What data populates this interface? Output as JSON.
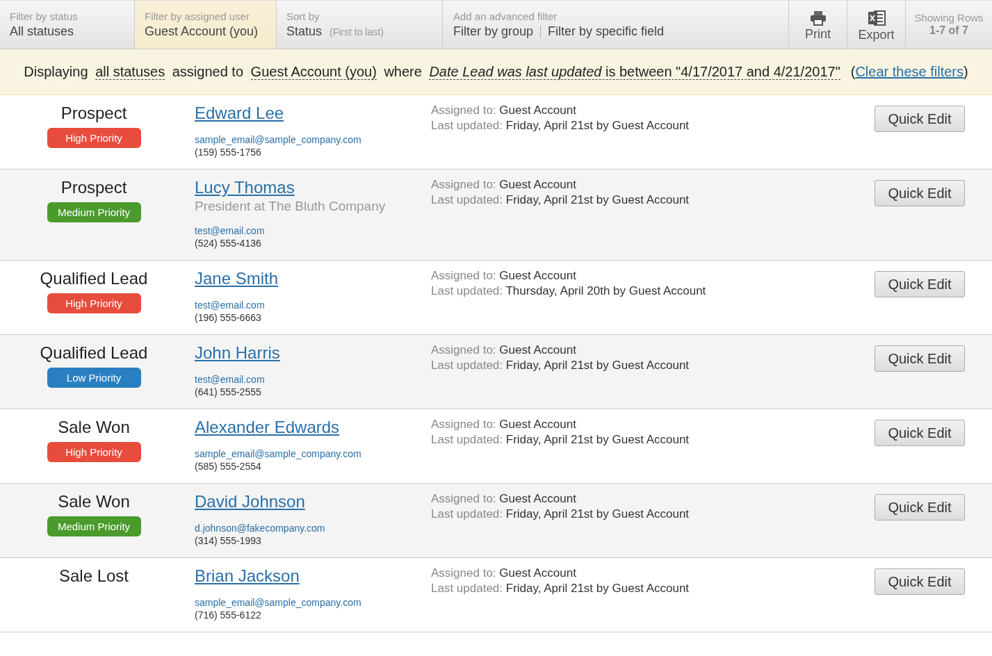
{
  "toolbar": {
    "tabs": [
      {
        "label": "Filter by status",
        "value": "All statuses",
        "selected": false
      },
      {
        "label": "Filter by assigned user",
        "value": "Guest Account (you)",
        "selected": true
      },
      {
        "label": "Sort by",
        "value": "Status",
        "note": "(First to last)",
        "selected": false
      }
    ],
    "advanced_filter": {
      "label": "Add an advanced filter",
      "links": [
        "Filter by group",
        "Filter by specific field"
      ]
    },
    "actions": [
      {
        "kind": "print",
        "label": "Print"
      },
      {
        "kind": "export",
        "label": "Export"
      }
    ],
    "row_count": {
      "label": "Showing Rows",
      "value": "1-7 of 7"
    }
  },
  "filter_summary": {
    "parts": [
      {
        "kind": "plain",
        "text": "Displaying"
      },
      {
        "kind": "value",
        "text": "all statuses"
      },
      {
        "kind": "plain",
        "text": "assigned to"
      },
      {
        "kind": "value",
        "text": "Guest Account (you)"
      },
      {
        "kind": "plain",
        "text": "where"
      },
      {
        "kind": "value",
        "text": "*Date Lead was last updated* is between \"4/17/2017 and 4/21/2017\""
      }
    ],
    "clear_open": "(",
    "clear_link": "Clear these filters",
    "clear_close": ")"
  },
  "leads": [
    {
      "status": "Prospect",
      "priority": {
        "label": "High Priority",
        "color": "#e74c3c"
      },
      "name": "Edward Lee",
      "email": "sample_email@sample_company.com",
      "phone": "(159) 555-1756",
      "assigned_label": "Assigned to:",
      "assigned": "Guest Account",
      "updated_label": "Last updated:",
      "updated": "Friday, April 21st by Guest Account",
      "action": "Quick Edit"
    },
    {
      "status": "Prospect",
      "priority": {
        "label": "Medium Priority",
        "color": "#4a9a2c"
      },
      "name": "Lucy Thomas",
      "subtitle": "President at The Bluth Company",
      "email": "test@email.com",
      "phone": "(524) 555-4136",
      "assigned_label": "Assigned to:",
      "assigned": "Guest Account",
      "updated_label": "Last updated:",
      "updated": "Friday, April 21st by Guest Account",
      "action": "Quick Edit"
    },
    {
      "status": "Qualified Lead",
      "priority": {
        "label": "High Priority",
        "color": "#e74c3c"
      },
      "name": "Jane Smith",
      "email": "test@email.com",
      "phone": "(196) 555-6663",
      "assigned_label": "Assigned to:",
      "assigned": "Guest Account",
      "updated_label": "Last updated:",
      "updated": "Thursday, April 20th by Guest Account",
      "action": "Quick Edit"
    },
    {
      "status": "Qualified Lead",
      "priority": {
        "label": "Low Priority",
        "color": "#2a7fc0"
      },
      "name": "John Harris",
      "email": "test@email.com",
      "phone": "(641) 555-2555",
      "assigned_label": "Assigned to:",
      "assigned": "Guest Account",
      "updated_label": "Last updated:",
      "updated": "Friday, April 21st by Guest Account",
      "action": "Quick Edit"
    },
    {
      "status": "Sale Won",
      "priority": {
        "label": "High Priority",
        "color": "#e74c3c"
      },
      "name": "Alexander Edwards",
      "email": "sample_email@sample_company.com",
      "phone": "(585) 555-2554",
      "assigned_label": "Assigned to:",
      "assigned": "Guest Account",
      "updated_label": "Last updated:",
      "updated": "Friday, April 21st by Guest Account",
      "action": "Quick Edit"
    },
    {
      "status": "Sale Won",
      "priority": {
        "label": "Medium Priority",
        "color": "#4a9a2c"
      },
      "name": "David Johnson",
      "email": "d.johnson@fakecompany.com",
      "phone": "(314) 555-1993",
      "assigned_label": "Assigned to:",
      "assigned": "Guest Account",
      "updated_label": "Last updated:",
      "updated": "Friday, April 21st by Guest Account",
      "action": "Quick Edit"
    },
    {
      "status": "Sale Lost",
      "name": "Brian Jackson",
      "email": "sample_email@sample_company.com",
      "phone": "(716) 555-6122",
      "assigned_label": "Assigned to:",
      "assigned": "Guest Account",
      "updated_label": "Last updated:",
      "updated": "Friday, April 21st by Guest Account",
      "action": "Quick Edit"
    }
  ]
}
